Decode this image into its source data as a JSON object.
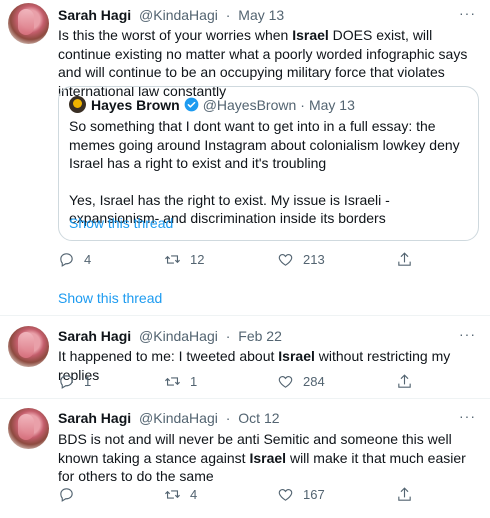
{
  "tweets": [
    {
      "author": "Sarah Hagi",
      "handle": "@KindaHagi",
      "date": "May 13",
      "text_parts": [
        "Is this the worst of your worries when ",
        "Israel",
        " DOES exist, will continue existing no matter what a poorly worded infographic says and will continue to be an occupying military force that violates international law constantly"
      ],
      "quote": {
        "author": "Hayes Brown",
        "handle": "@HayesBrown",
        "date": "May 13",
        "para1": "So something that I dont want to get into in a full essay: the memes going around Instagram about colonialism lowkey deny Israel has a right to exist and it's troubling",
        "para2": "Yes, Israel has the right to exist. My issue is Israeli -expansionism- and discrimination inside its borders",
        "show_thread": "Show this thread"
      },
      "replies": "4",
      "retweets": "12",
      "likes": "213"
    },
    {
      "author": "Sarah Hagi",
      "handle": "@KindaHagi",
      "date": "Feb 22",
      "text_parts": [
        "It happened to me: I tweeted about ",
        "Israel",
        " without restricting my replies"
      ],
      "replies": "1",
      "retweets": "1",
      "likes": "284"
    },
    {
      "author": "Sarah Hagi",
      "handle": "@KindaHagi",
      "date": "Oct 12",
      "text_parts": [
        "BDS is not and will never be anti Semitic and someone this well known taking a stance against ",
        "Israel",
        " will make it that much easier for others to do the same"
      ],
      "replies": "",
      "retweets": "4",
      "likes": "167"
    }
  ],
  "show_thread": "Show this thread",
  "separator": "·",
  "more_glyph": "···",
  "icons": {
    "reply": "reply-icon",
    "retweet": "retweet-icon",
    "like": "heart-icon",
    "share": "share-icon",
    "verified": "verified-badge-icon"
  },
  "colors": {
    "link": "#1d9bf0",
    "meta": "#536471",
    "text": "#0f1419",
    "verified": "#1d9bf0"
  }
}
